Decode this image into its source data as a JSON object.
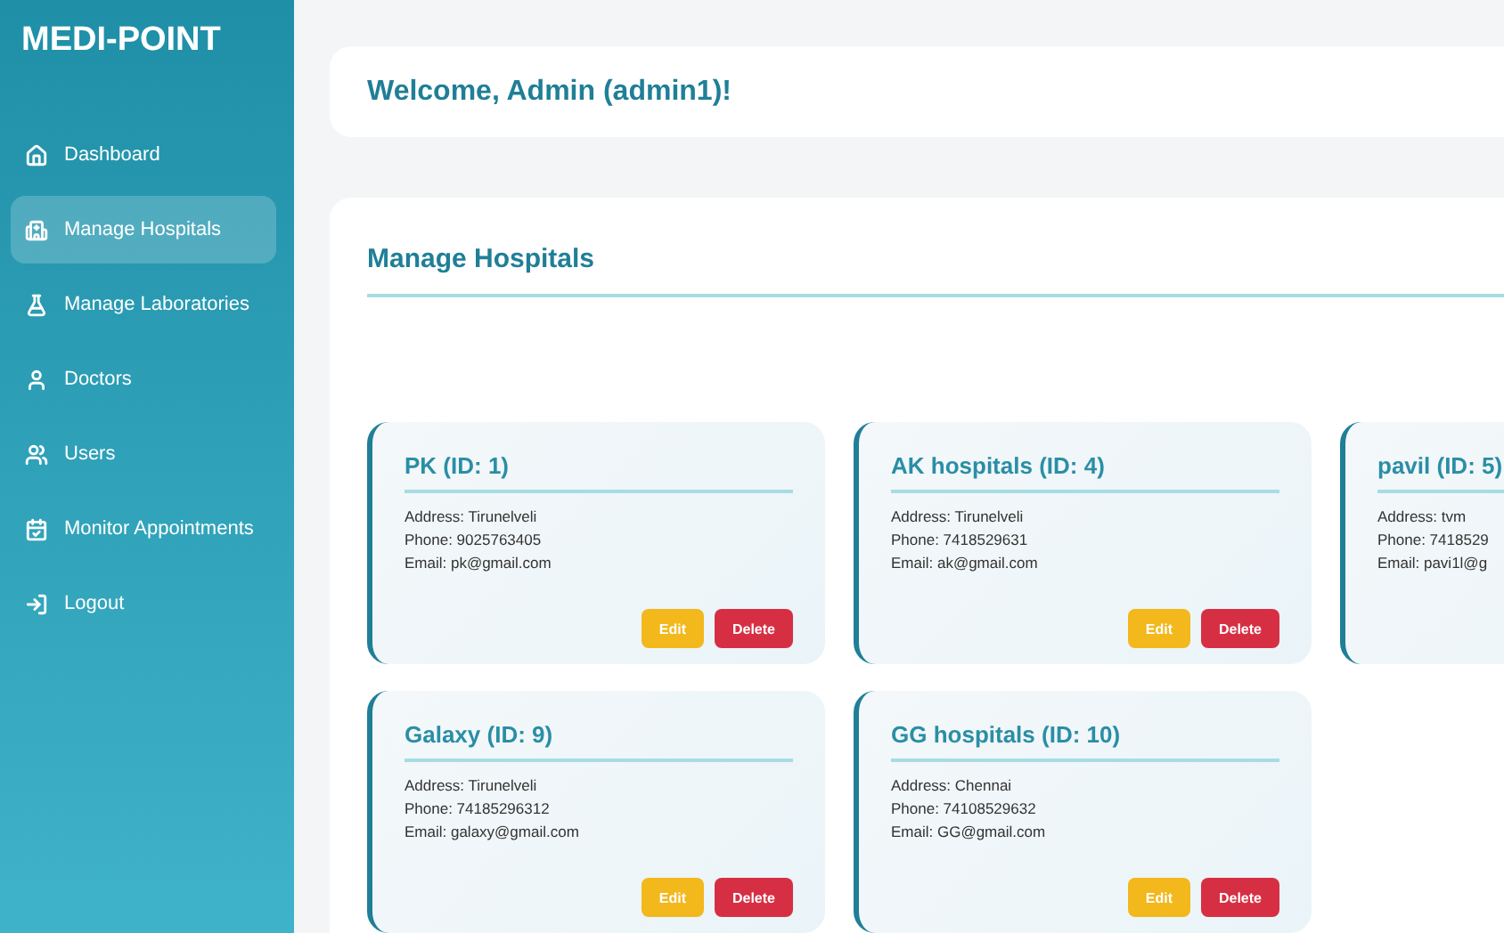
{
  "sidebar": {
    "brand": "MEDI-POINT",
    "items": [
      {
        "label": "Dashboard",
        "selected": false
      },
      {
        "label": "Manage Hospitals",
        "selected": true
      },
      {
        "label": "Manage Laboratories",
        "selected": false
      },
      {
        "label": "Doctors",
        "selected": false
      },
      {
        "label": "Users",
        "selected": false
      },
      {
        "label": "Monitor Appointments",
        "selected": false
      },
      {
        "label": "Logout",
        "selected": false
      }
    ]
  },
  "header": {
    "title": "Welcome, Admin (admin1)!"
  },
  "section": {
    "title": "Manage Hospitals",
    "hospitals": [
      {
        "name": "PK (ID: 1)",
        "address": "Address: Tirunelveli",
        "phone": "Phone: 9025763405",
        "email": "Email: pk@gmail.com",
        "buttons": [
          "Edit",
          "Delete"
        ]
      },
      {
        "name": "AK hospitals (ID: 4)",
        "address": "Address: Tirunelveli",
        "phone": "Phone: 7418529631",
        "email": "Email: ak@gmail.com",
        "buttons": [
          "Edit",
          "Delete"
        ]
      },
      {
        "name": "pavil (ID: 5)",
        "address": "Address: tvm",
        "phone": "Phone: 7418529",
        "email": "Email: pavi1l@g"
      },
      {
        "name": "Galaxy (ID: 9)",
        "address": "Address: Tirunelveli",
        "phone": "Phone: 74185296312",
        "email": "Email: galaxy@gmail.com",
        "buttons": [
          "Edit",
          "Delete"
        ]
      },
      {
        "name": "GG hospitals (ID: 10)",
        "address": "Address: Chennai",
        "phone": "Phone: 74108529632",
        "email": "Email: GG@gmail.com",
        "buttons": [
          "Edit",
          "Delete"
        ]
      }
    ]
  }
}
